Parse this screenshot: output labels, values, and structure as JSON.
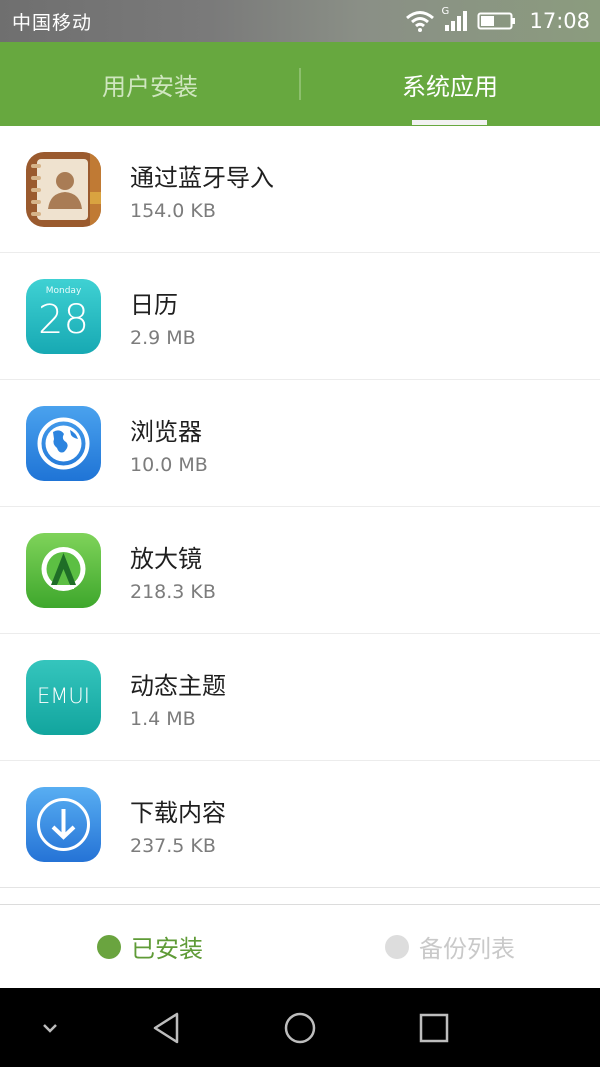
{
  "status_bar": {
    "carrier": "中国移动",
    "network_type": "G",
    "time": "17:08",
    "icons": [
      "wifi-icon",
      "signal-icon",
      "battery-icon"
    ]
  },
  "tabs": [
    {
      "label": "用户安装",
      "active": false
    },
    {
      "label": "系统应用",
      "active": true
    }
  ],
  "apps": [
    {
      "name": "通过蓝牙导入",
      "size": "154.0 KB",
      "icon": "contacts-icon"
    },
    {
      "name": "日历",
      "size": "2.9 MB",
      "icon": "calendar-icon",
      "icon_weekday": "Monday",
      "icon_day": "28"
    },
    {
      "name": "浏览器",
      "size": "10.0 MB",
      "icon": "browser-icon"
    },
    {
      "name": "放大镜",
      "size": "218.3 KB",
      "icon": "magnifier-icon"
    },
    {
      "name": "动态主题",
      "size": "1.4 MB",
      "icon": "themes-icon",
      "icon_text": "EMUI"
    },
    {
      "name": "下载内容",
      "size": "237.5 KB",
      "icon": "downloads-icon"
    }
  ],
  "bottom_tabs": [
    {
      "label": "已安装",
      "active": true
    },
    {
      "label": "备份列表",
      "active": false
    }
  ],
  "nav_bar": [
    "chevron-down-icon",
    "back-icon",
    "home-icon",
    "recents-icon"
  ],
  "colors": {
    "accent_green": "#67a83f",
    "active_bottom_text": "#5f9b37"
  }
}
